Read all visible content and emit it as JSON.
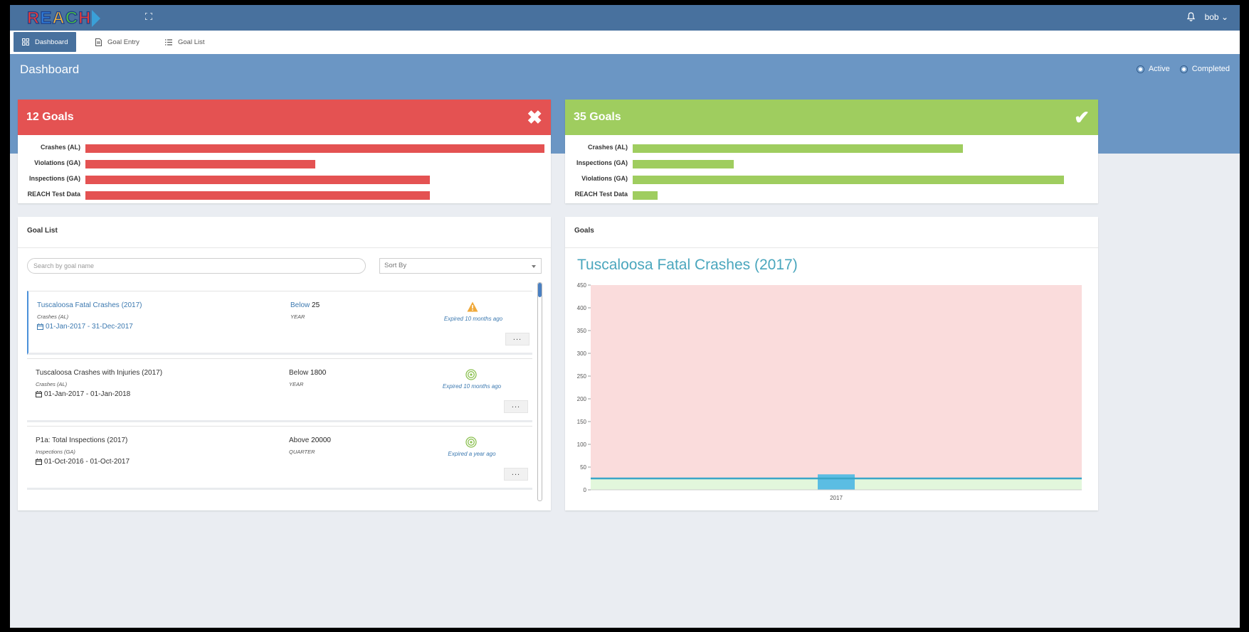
{
  "app": {
    "logo_text": "REACH",
    "user": "bob"
  },
  "nav": {
    "items": [
      {
        "label": "Dashboard",
        "icon": "grid-icon",
        "active": true
      },
      {
        "label": "Goal Entry",
        "icon": "document-icon",
        "active": false
      },
      {
        "label": "Goal List",
        "icon": "list-icon",
        "active": false
      }
    ]
  },
  "page": {
    "title": "Dashboard",
    "filters": [
      {
        "label": "Active",
        "checked": false
      },
      {
        "label": "Completed",
        "checked": false
      }
    ]
  },
  "failed_goals": {
    "title": "12 Goals",
    "icon": "close-icon",
    "color": "#e45252",
    "items": [
      {
        "label": "Crashes (AL)",
        "value": 1.0
      },
      {
        "label": "Violations (GA)",
        "value": 0.5
      },
      {
        "label": "Inspections (GA)",
        "value": 0.75
      },
      {
        "label": "REACH Test Data",
        "value": 0.75
      }
    ]
  },
  "met_goals": {
    "title": "35 Goals",
    "icon": "check-icon",
    "color": "#9fcd5f",
    "items": [
      {
        "label": "Crashes (AL)",
        "value": 0.72
      },
      {
        "label": "Inspections (GA)",
        "value": 0.22
      },
      {
        "label": "Violations (GA)",
        "value": 0.94
      },
      {
        "label": "REACH Test Data",
        "value": 0.055
      }
    ]
  },
  "goal_list": {
    "title": "Goal List",
    "search_placeholder": "Search by goal name",
    "sort_label": "Sort By",
    "items": [
      {
        "name": "Tuscaloosa Fatal Crashes (2017)",
        "category": "Crashes (AL)",
        "dates": "01-Jan-2017 - 31-Dec-2017",
        "direction": "Below",
        "target": "25",
        "period": "YEAR",
        "status_icon": "warning-icon",
        "expired": "Expired 10 months ago",
        "more": "...",
        "selected": true
      },
      {
        "name": "Tuscaloosa Crashes with Injuries (2017)",
        "category": "Crashes (AL)",
        "dates": "01-Jan-2017 - 01-Jan-2018",
        "direction": "Below",
        "target": "1800",
        "period": "YEAR",
        "status_icon": "target-icon",
        "expired": "Expired 10 months ago",
        "more": "...",
        "selected": false
      },
      {
        "name": "P1a: Total Inspections (2017)",
        "category": "Inspections (GA)",
        "dates": "01-Oct-2016 - 01-Oct-2017",
        "direction": "Above",
        "target": "20000",
        "period": "QUARTER",
        "status_icon": "target-icon",
        "expired": "Expired a year ago",
        "more": "...",
        "selected": false
      }
    ]
  },
  "goals_panel": {
    "title": "Goals"
  },
  "chart_data": {
    "type": "bar",
    "title": "Tuscaloosa Fatal Crashes (2017)",
    "categories": [
      "2017"
    ],
    "values": [
      34
    ],
    "goal_line": 25,
    "ylim": [
      0,
      450
    ],
    "yticks": [
      0,
      50,
      100,
      150,
      200,
      250,
      300,
      350,
      400,
      450
    ],
    "fail_zone_color": "#fadcdc",
    "pass_zone_color": "#e2f7dc",
    "bar_color": "#5bbde3",
    "goal_line_color": "#3aa6c8"
  }
}
